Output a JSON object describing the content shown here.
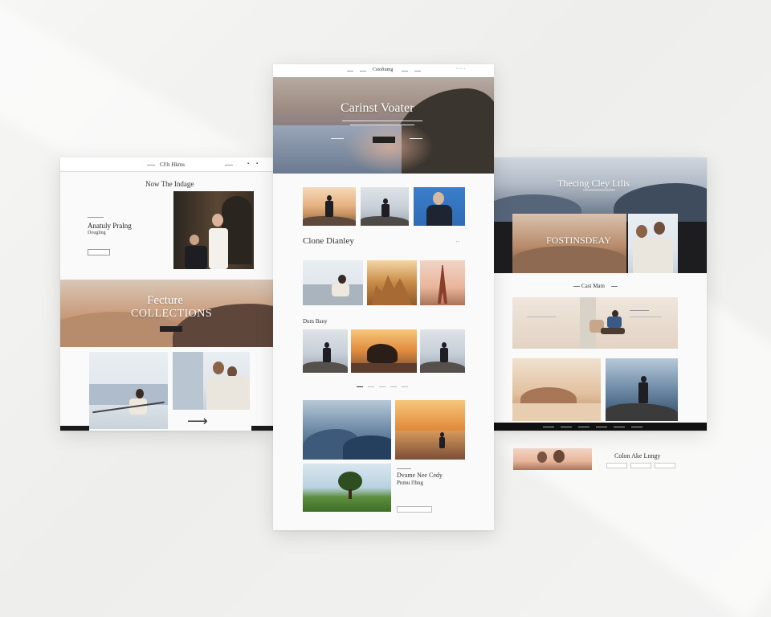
{
  "left_page": {
    "nav_brand": "Cl!h Hkms",
    "heading": "Now The Indage",
    "feature_title": "Anatuly Pralng",
    "feature_subtitle": "Dougling",
    "hero_line1": "Fecture",
    "hero_line2": "COLLECTIONS"
  },
  "center_page": {
    "nav_brand": "Cstoftumg",
    "hero_title": "Carinst Voater",
    "section_title": "Clone Dianley",
    "label_small": "Dum Bany",
    "feature_title_line1": "Dvame Nee Cedy",
    "feature_title_line2": "Pnmu l!hng"
  },
  "right_page": {
    "hero_title": "Thecing Cley Ltlis",
    "banner_title": "FOSTINSDEAY",
    "section_title": "Cast Mam",
    "footer_title": "Colon Ake Lnngy"
  },
  "colors": {
    "background": "#f2f2f1",
    "page": "#fafafa",
    "dark_bar": "#1a1a1a"
  },
  "icons": [
    "search-icon",
    "menu-icon",
    "arrow-icon"
  ]
}
